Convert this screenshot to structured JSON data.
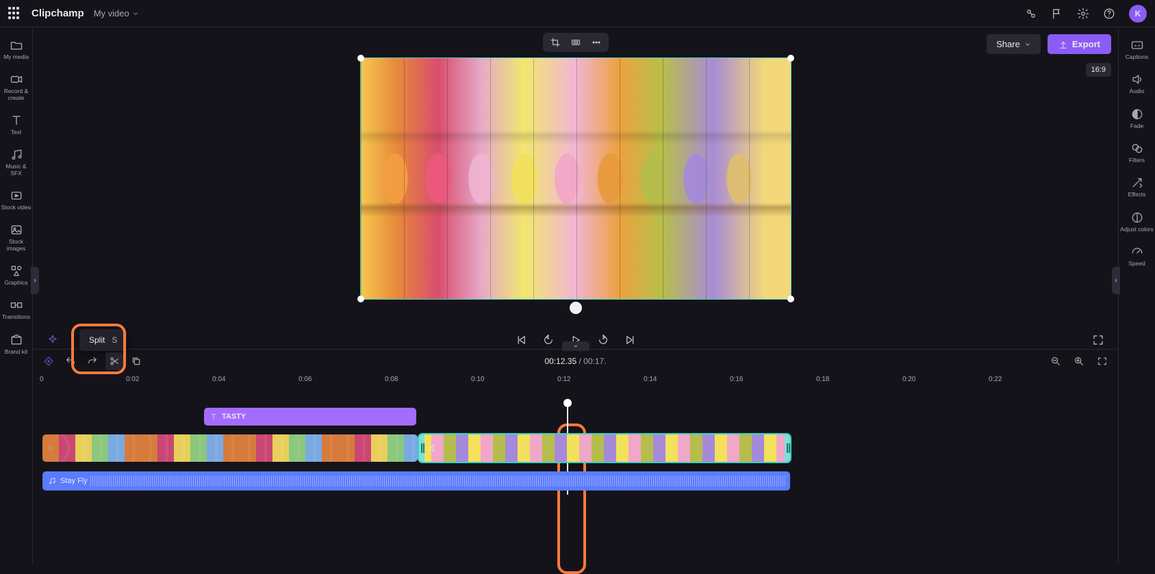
{
  "app": {
    "brand": "Clipchamp",
    "project": "My video",
    "avatar_initial": "K"
  },
  "topbar": {
    "share": "Share",
    "export": "Export",
    "aspect": "16:9"
  },
  "left_rail": [
    {
      "label": "My media"
    },
    {
      "label": "Record & create"
    },
    {
      "label": "Text"
    },
    {
      "label": "Music & SFX"
    },
    {
      "label": "Stock video"
    },
    {
      "label": "Stock images"
    },
    {
      "label": "Graphics"
    },
    {
      "label": "Transitions"
    },
    {
      "label": "Brand kit"
    }
  ],
  "right_rail": [
    {
      "label": "Captions"
    },
    {
      "label": "Audio"
    },
    {
      "label": "Fade"
    },
    {
      "label": "Filters"
    },
    {
      "label": "Effects"
    },
    {
      "label": "Adjust colors"
    },
    {
      "label": "Speed"
    }
  ],
  "time": {
    "current": "00:12.35",
    "sep": " / ",
    "total": "00:17."
  },
  "tooltip": {
    "label": "Split",
    "shortcut": "S"
  },
  "ruler": [
    "0",
    "0:02",
    "0:04",
    "0:06",
    "0:08",
    "0:10",
    "0:12",
    "0:14",
    "0:16",
    "0:18",
    "0:20",
    "0:22"
  ],
  "clips": {
    "text_label": "TASTY",
    "audio_label": "Stay Fly"
  }
}
